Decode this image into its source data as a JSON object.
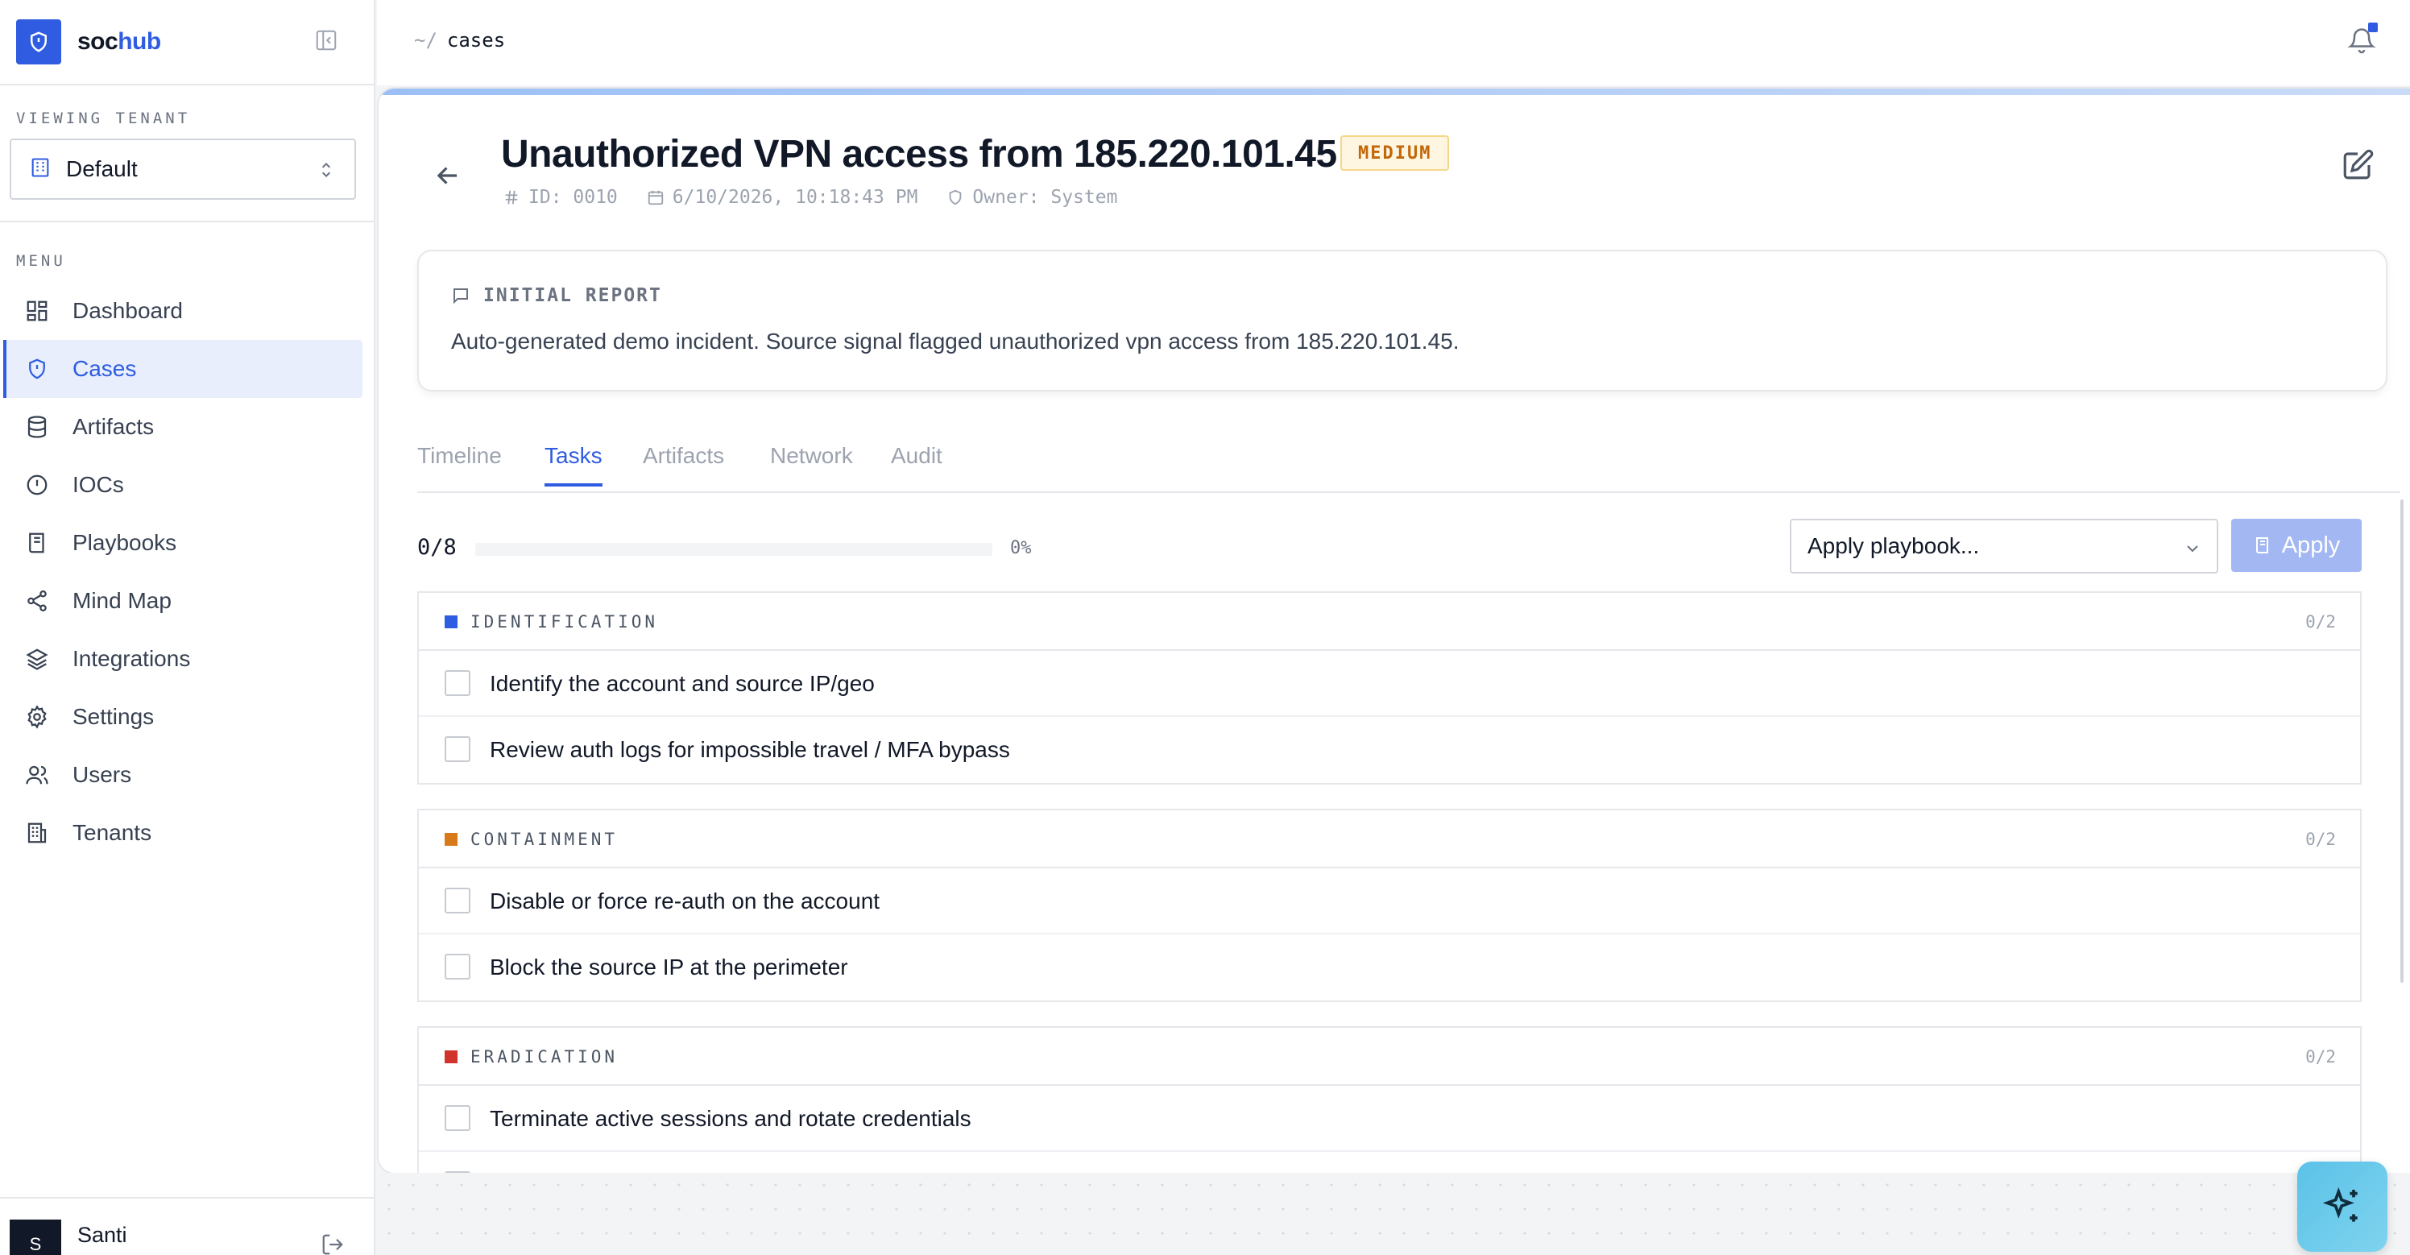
{
  "brand": {
    "part1": "soc",
    "part2": "hub"
  },
  "tenant": {
    "label": "VIEWING TENANT",
    "value": "Default"
  },
  "menu": {
    "label": "MENU",
    "items": [
      {
        "label": "Dashboard",
        "icon": "grid-icon"
      },
      {
        "label": "Cases",
        "icon": "shield-icon",
        "active": true
      },
      {
        "label": "Artifacts",
        "icon": "database-icon"
      },
      {
        "label": "IOCs",
        "icon": "alert-circle-icon"
      },
      {
        "label": "Playbooks",
        "icon": "book-icon"
      },
      {
        "label": "Mind Map",
        "icon": "share-icon"
      },
      {
        "label": "Integrations",
        "icon": "layers-icon"
      },
      {
        "label": "Settings",
        "icon": "gear-icon"
      },
      {
        "label": "Users",
        "icon": "users-icon"
      },
      {
        "label": "Tenants",
        "icon": "building-icon"
      }
    ]
  },
  "user": {
    "initial": "S",
    "name": "Santi"
  },
  "breadcrumb": {
    "prefix": "~/",
    "current": "cases"
  },
  "case": {
    "title": "Unauthorized VPN access from 185.220.101.45",
    "severity": "MEDIUM",
    "id": "ID: 0010",
    "date": "6/10/2026, 10:18:43 PM",
    "owner": "Owner: System"
  },
  "report": {
    "heading": "INITIAL REPORT",
    "text": "Auto-generated demo incident. Source signal flagged unauthorized vpn access from 185.220.101.45."
  },
  "tabs": [
    "Timeline",
    "Tasks",
    "Artifacts",
    "Network",
    "Audit"
  ],
  "active_tab": "Tasks",
  "progress": {
    "count": "0/8",
    "percent": "0%",
    "fraction": 0
  },
  "playbook": {
    "placeholder": "Apply playbook...",
    "apply_label": "Apply"
  },
  "phases": [
    {
      "name": "IDENTIFICATION",
      "count": "0/2",
      "color": "#2f5ce0",
      "tasks": [
        "Identify the account and source IP/geo",
        "Review auth logs for impossible travel / MFA bypass"
      ]
    },
    {
      "name": "CONTAINMENT",
      "count": "0/2",
      "color": "#d97a1a",
      "tasks": [
        "Disable or force re-auth on the account",
        "Block the source IP at the perimeter"
      ]
    },
    {
      "name": "ERADICATION",
      "count": "0/2",
      "color": "#d0342c",
      "tasks": [
        "Terminate active sessions and rotate credentials"
      ]
    }
  ],
  "colors": {
    "accent": "#2f5ce0",
    "severity_medium": "#c2680c"
  }
}
